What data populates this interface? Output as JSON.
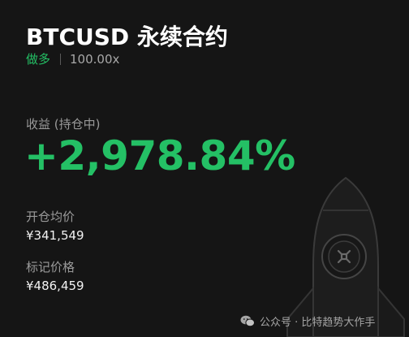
{
  "header": {
    "title": "BTCUSD 永续合约",
    "direction": "做多",
    "leverage": "100.00x"
  },
  "pnl": {
    "label": "收益 (持仓中)",
    "value": "+2,978.84%"
  },
  "stats": [
    {
      "label": "开仓均价",
      "value": "¥341,549"
    },
    {
      "label": "标记价格",
      "value": "¥486,459"
    }
  ],
  "watermark": {
    "text": "公众号 · 比特趋势大作手"
  },
  "colors": {
    "background": "#151515",
    "positive": "#24c065",
    "text": "#ffffff",
    "muted": "#9a9a9a"
  },
  "icons": {
    "illustration": "rocket-icon",
    "watermark": "wechat-icon"
  }
}
